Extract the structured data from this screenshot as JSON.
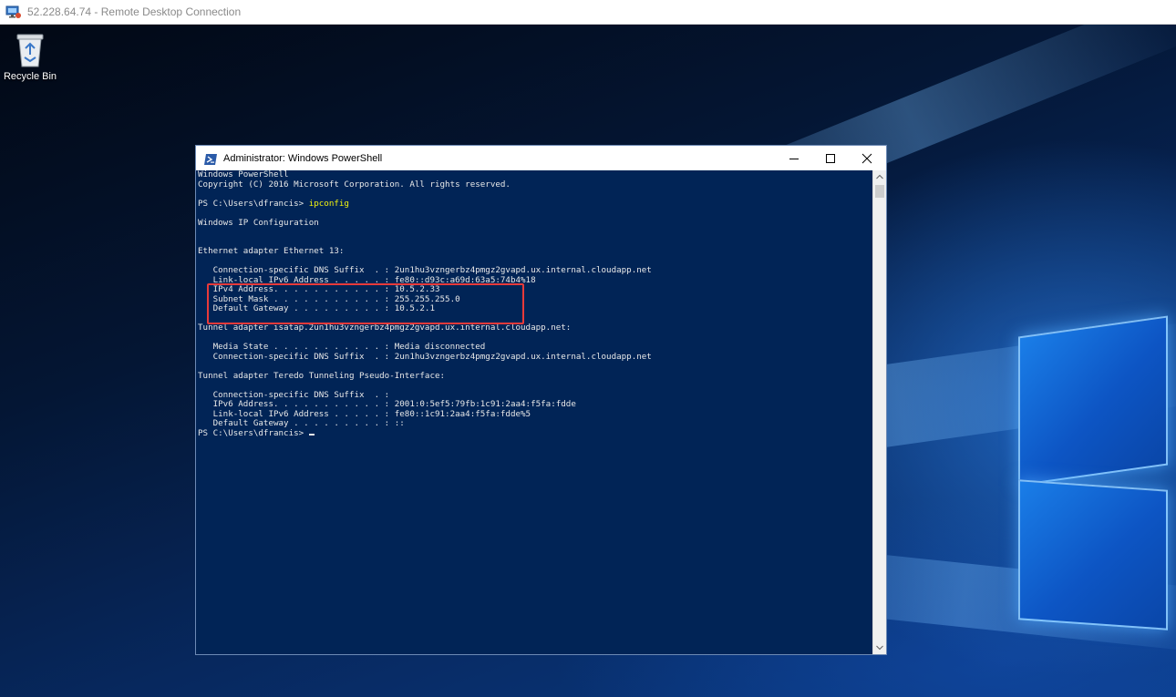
{
  "rdp": {
    "title": "52.228.64.74 - Remote Desktop Connection"
  },
  "desktop": {
    "recycle_bin_label": "Recycle Bin"
  },
  "window": {
    "title": "Administrator: Windows PowerShell"
  },
  "console": {
    "line1": "Windows PowerShell",
    "line2": "Copyright (C) 2016 Microsoft Corporation. All rights reserved.",
    "prompt1": "PS C:\\Users\\dfrancis> ",
    "command": "ipconfig",
    "ipconfig_header": "Windows IP Configuration",
    "eth_header": "Ethernet adapter Ethernet 13:",
    "eth_dns_suffix": "   Connection-specific DNS Suffix  . : 2un1hu3vzngerbz4pmgz2gvapd.ux.internal.cloudapp.net",
    "eth_link_local": "   Link-local IPv6 Address . . . . . : fe80::d93c:a69d:63a5:74b4%18",
    "eth_ipv4": "   IPv4 Address. . . . . . . . . . . : 10.5.2.33",
    "eth_subnet": "   Subnet Mask . . . . . . . . . . . : 255.255.255.0",
    "eth_gateway": "   Default Gateway . . . . . . . . . : 10.5.2.1",
    "isatap_header": "Tunnel adapter isatap.2un1hu3vzngerbz4pmgz2gvapd.ux.internal.cloudapp.net:",
    "isatap_media": "   Media State . . . . . . . . . . . : Media disconnected",
    "isatap_dns": "   Connection-specific DNS Suffix  . : 2un1hu3vzngerbz4pmgz2gvapd.ux.internal.cloudapp.net",
    "teredo_header": "Tunnel adapter Teredo Tunneling Pseudo-Interface:",
    "teredo_dns": "   Connection-specific DNS Suffix  . :",
    "teredo_ipv6": "   IPv6 Address. . . . . . . . . . . : 2001:0:5ef5:79fb:1c91:2aa4:f5fa:fdde",
    "teredo_link_local": "   Link-local IPv6 Address . . . . . : fe80::1c91:2aa4:f5fa:fdde%5",
    "teredo_gateway": "   Default Gateway . . . . . . . . . : ::",
    "prompt2": "PS C:\\Users\\dfrancis> "
  },
  "icons": [
    "rdp-icon",
    "recycle-bin-icon",
    "powershell-icon",
    "minimize-icon",
    "maximize-icon",
    "close-icon",
    "scroll-up-icon",
    "scroll-down-icon"
  ],
  "colors": {
    "console_bg": "#012456",
    "command": "#f2f20f",
    "highlight": "#e83a3a"
  }
}
